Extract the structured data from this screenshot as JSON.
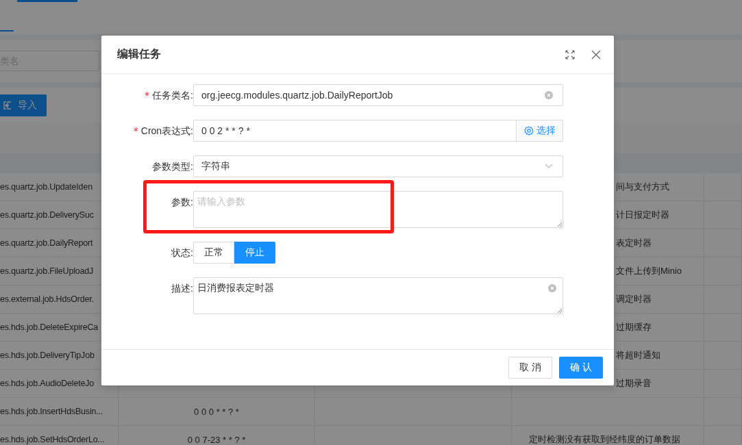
{
  "page": {
    "search_placeholder": "类名",
    "import_button": "导入",
    "table": {
      "rows": [
        {
          "class_name": "es.quartz.job.UpdateIden",
          "description": "间与支付方式"
        },
        {
          "class_name": "es.quartz.job.DeliverySuc",
          "description": "计日报定时器"
        },
        {
          "class_name": "es.quartz.job.DailyReport",
          "description": "表定时器"
        },
        {
          "class_name": "es.quartz.job.FileUploadJ",
          "description": "文件上传到Minio"
        },
        {
          "class_name": "es.external.job.HdsOrder.",
          "description": "调定时器"
        },
        {
          "class_name": "es.hds.job.DeleteExpireCa",
          "description": "过期缓存"
        },
        {
          "class_name": "es.hds.job.DeliveryTipJob",
          "description": "将超时通知"
        },
        {
          "class_name": "es.hds.job.AudioDeleteJo",
          "description": "过期录音"
        },
        {
          "class_name": "es.hds.job.InsertHdsBusin...",
          "cron": "0 0 0 * * ? *"
        },
        {
          "class_name": "es.hds.job.SetHdsOrderLo...",
          "cron": "0 0 7-23 * * ? *",
          "description": "定时检测没有获取到经纬度的订单数据"
        }
      ]
    }
  },
  "dialog": {
    "title": "编辑任务",
    "fields": [
      {
        "kind": "input",
        "required_mark": "*",
        "label": "任务类名:",
        "value": "org.jeecg.modules.quartz.job.DailyReportJob"
      },
      {
        "kind": "cron",
        "required_mark": "*",
        "label": "Cron表达式:",
        "value": "0 0 2 * * ? *",
        "button": "选择"
      },
      {
        "kind": "select",
        "label": "参数类型:",
        "value": "字符串"
      },
      {
        "kind": "textarea",
        "label": "参数:",
        "placeholder": "请输入参数"
      },
      {
        "kind": "radio",
        "label": "状态:",
        "options": [
          {
            "label": "正常",
            "selected": false
          },
          {
            "label": "停止",
            "selected": true
          }
        ]
      },
      {
        "kind": "textarea",
        "label": "描述:",
        "value": "日消费报表定时器"
      }
    ],
    "buttons": [
      {
        "label": "取 消",
        "primary": false
      },
      {
        "label": "确 认",
        "primary": true
      }
    ]
  }
}
